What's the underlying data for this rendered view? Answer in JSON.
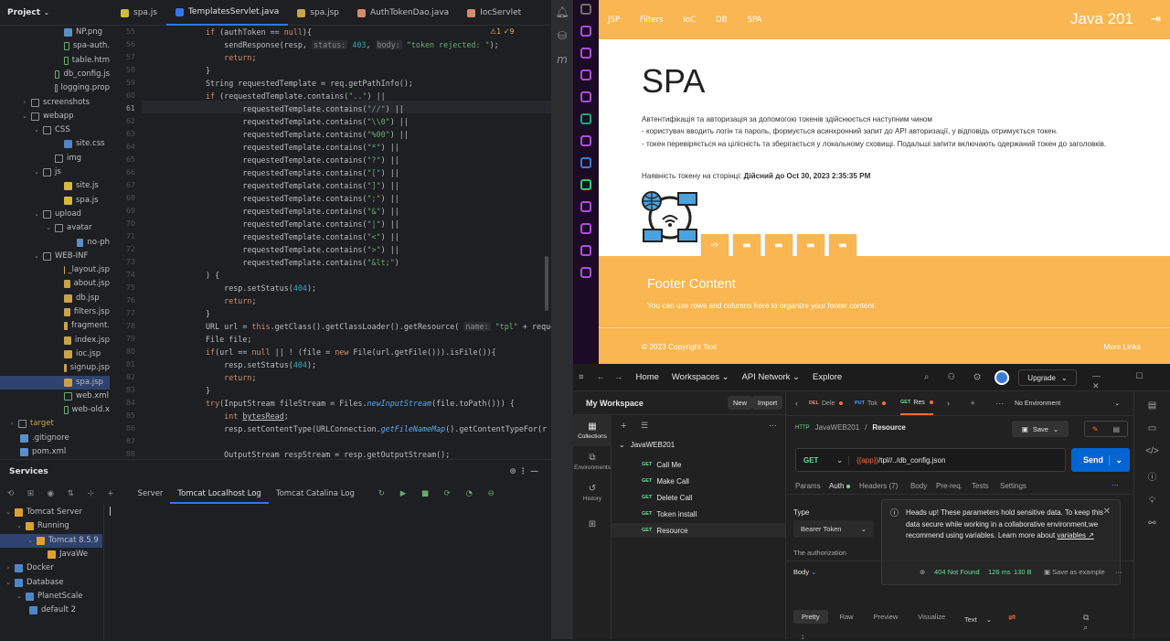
{
  "ide": {
    "project_label": "Project",
    "tabs": [
      {
        "label": "spa.js",
        "color": "#d4b840"
      },
      {
        "label": "TemplatesServlet.java",
        "color": "#3574f0"
      },
      {
        "label": "spa.jsp",
        "color": "#c9a24a"
      },
      {
        "label": "AuthTokenDao.java",
        "color": "#cf8e6d"
      },
      {
        "label": "IocServlet",
        "color": "#cf8e6d"
      }
    ],
    "tree": [
      {
        "label": "NP.png",
        "indent": 70,
        "icon": "file",
        "caret": ""
      },
      {
        "label": "spa-auth.",
        "indent": 70,
        "icon": "html",
        "caret": ""
      },
      {
        "label": "table.htm",
        "indent": 70,
        "icon": "html",
        "caret": ""
      },
      {
        "label": "db_config.js",
        "indent": 60,
        "icon": "html",
        "caret": ""
      },
      {
        "label": "logging.prop",
        "indent": 60,
        "icon": "folder",
        "caret": ""
      },
      {
        "label": "screenshots",
        "indent": 34,
        "icon": "folder",
        "caret": "›"
      },
      {
        "label": "webapp",
        "indent": 34,
        "icon": "folder",
        "caret": "⌄"
      },
      {
        "label": "CSS",
        "indent": 47,
        "icon": "folder",
        "caret": "⌄"
      },
      {
        "label": "site.css",
        "indent": 70,
        "icon": "css",
        "caret": ""
      },
      {
        "label": "img",
        "indent": 60,
        "icon": "folder",
        "caret": ""
      },
      {
        "label": "js",
        "indent": 47,
        "icon": "folder",
        "caret": "⌄"
      },
      {
        "label": "site.js",
        "indent": 70,
        "icon": "js",
        "caret": ""
      },
      {
        "label": "spa.js",
        "indent": 70,
        "icon": "js",
        "caret": ""
      },
      {
        "label": "upload",
        "indent": 47,
        "icon": "folder",
        "caret": "⌄"
      },
      {
        "label": "avatar",
        "indent": 60,
        "icon": "folder",
        "caret": "⌄"
      },
      {
        "label": "no-ph",
        "indent": 84,
        "icon": "file",
        "caret": ""
      },
      {
        "label": "WEB-INF",
        "indent": 47,
        "icon": "folder",
        "caret": "⌄"
      },
      {
        "label": "_layout.jsp",
        "indent": 70,
        "icon": "jsp",
        "caret": ""
      },
      {
        "label": "about.jsp",
        "indent": 70,
        "icon": "jsp",
        "caret": ""
      },
      {
        "label": "db.jsp",
        "indent": 70,
        "icon": "jsp",
        "caret": ""
      },
      {
        "label": "filters.jsp",
        "indent": 70,
        "icon": "jsp",
        "caret": ""
      },
      {
        "label": "fragment.",
        "indent": 70,
        "icon": "jsp",
        "caret": ""
      },
      {
        "label": "index.jsp",
        "indent": 70,
        "icon": "jsp",
        "caret": ""
      },
      {
        "label": "ioc.jsp",
        "indent": 70,
        "icon": "jsp",
        "caret": ""
      },
      {
        "label": "signup.jsp",
        "indent": 70,
        "icon": "jsp",
        "caret": ""
      },
      {
        "label": "spa.jsp",
        "indent": 70,
        "icon": "jsp",
        "caret": ""
      },
      {
        "label": "web.xml",
        "indent": 70,
        "icon": "html",
        "caret": ""
      },
      {
        "label": "web-old.x",
        "indent": 70,
        "icon": "html",
        "caret": ""
      },
      {
        "label": "target",
        "indent": 8,
        "icon": "folder",
        "caret": "›"
      },
      {
        "label": ".gitignore",
        "indent": 22,
        "icon": "file",
        "caret": ""
      },
      {
        "label": "pom.xml",
        "indent": 22,
        "icon": "file",
        "caret": ""
      }
    ],
    "inspections": "⚠1 ✓9",
    "code": [
      {
        "n": "55",
        "h": "<span class=\"k\">if</span> (authToken == <span class=\"k\">null</span>){"
      },
      {
        "n": "56",
        "h": "    sendResponse(resp, <span class=\"h\">status:</span> <span class=\"n\">403</span>, <span class=\"h\">body:</span> <span class=\"s\">\"token rejected: \"</span>);"
      },
      {
        "n": "57",
        "h": "    <span class=\"k\">return</span>;"
      },
      {
        "n": "58",
        "h": "}"
      },
      {
        "n": "59",
        "h": "String requestedTemplate = req.getPathInfo();"
      },
      {
        "n": "60",
        "h": "<span class=\"k\">if</span> (requestedTemplate.contains(<span class=\"s\">\"..\"</span>) ||"
      },
      {
        "n": "61",
        "h": "        requestedTemplate.contains(<span class=\"s\">\"//\"</span>) ||"
      },
      {
        "n": "62",
        "h": "        requestedTemplate.contains(<span class=\"s\">\"\\\\0\"</span>) ||"
      },
      {
        "n": "63",
        "h": "        requestedTemplate.contains(<span class=\"s\">\"%00\"</span>) ||"
      },
      {
        "n": "64",
        "h": "        requestedTemplate.contains(<span class=\"s\">\"*\"</span>) ||"
      },
      {
        "n": "65",
        "h": "        requestedTemplate.contains(<span class=\"s\">\"?\"</span>) ||"
      },
      {
        "n": "66",
        "h": "        requestedTemplate.contains(<span class=\"s\">\"[\"</span>) ||"
      },
      {
        "n": "67",
        "h": "        requestedTemplate.contains(<span class=\"s\">\"]\"</span>) ||"
      },
      {
        "n": "68",
        "h": "        requestedTemplate.contains(<span class=\"s\">\";\"</span>) ||"
      },
      {
        "n": "69",
        "h": "        requestedTemplate.contains(<span class=\"s\">\"&amp;\"</span>) ||"
      },
      {
        "n": "70",
        "h": "        requestedTemplate.contains(<span class=\"s\">\"|\"</span>) ||"
      },
      {
        "n": "71",
        "h": "        requestedTemplate.contains(<span class=\"s\">\"&lt;\"</span>) ||"
      },
      {
        "n": "72",
        "h": "        requestedTemplate.contains(<span class=\"s\">\"&gt;\"</span>) ||"
      },
      {
        "n": "73",
        "h": "        requestedTemplate.contains(<span class=\"s\">\"&amp;lt;\"</span>)"
      },
      {
        "n": "74",
        "h": ") {"
      },
      {
        "n": "75",
        "h": "    resp.setStatus(<span class=\"n\">404</span>);"
      },
      {
        "n": "76",
        "h": "    <span class=\"k\">return</span>;"
      },
      {
        "n": "77",
        "h": "}"
      },
      {
        "n": "78",
        "h": "URL url = <span class=\"k\">this</span>.getClass().getClassLoader().getResource( <span class=\"h\">name:</span> <span class=\"s\">\"tpl\"</span> + reque"
      },
      {
        "n": "79",
        "h": "File file;"
      },
      {
        "n": "80",
        "h": "<span class=\"k\">if</span>(url == <span class=\"k\">null</span> || ! (file = <span class=\"k\">new</span> File(url.getFile())).isFile()){"
      },
      {
        "n": "81",
        "h": "    resp.setStatus(<span class=\"n\">404</span>);"
      },
      {
        "n": "82",
        "h": "    <span class=\"k\">return</span>;"
      },
      {
        "n": "83",
        "h": "}"
      },
      {
        "n": "84",
        "h": "<span class=\"k\">try</span>(InputStream fileStream = Files.<span class=\"i\">newInputStream</span>(file.toPath())) {"
      },
      {
        "n": "85",
        "h": "    <span class=\"k\">int</span> <u>bytesRead</u>;"
      },
      {
        "n": "86",
        "h": "    resp.setContentType(URLConnection.<span class=\"i\">getFileNameMap</span>().getContentTypeFor(r"
      },
      {
        "n": "87",
        "h": ""
      },
      {
        "n": "88",
        "h": "    OutputStream respStream = resp.getOutputStream();"
      }
    ],
    "services": {
      "title": "Services",
      "tabs": [
        "Server",
        "Tomcat Localhost Log",
        "Tomcat Catalina Log"
      ],
      "active_tab": "Tomcat Localhost Log",
      "tree": [
        {
          "label": "Tomcat Server",
          "indent": 12,
          "caret": "⌄"
        },
        {
          "label": "Running",
          "indent": 24,
          "caret": "⌄"
        },
        {
          "label": "Tomcat 8.5.9",
          "indent": 36,
          "caret": "⌄"
        },
        {
          "label": "JavaWe",
          "indent": 60,
          "caret": ""
        },
        {
          "label": "Docker",
          "indent": 12,
          "caret": "›"
        },
        {
          "label": "Database",
          "indent": 12,
          "caret": "⌄"
        },
        {
          "label": "PlanetScale",
          "indent": 24,
          "caret": "⌄"
        },
        {
          "label": "default 2",
          "indent": 40,
          "caret": ""
        }
      ]
    }
  },
  "browser": {
    "nav": [
      "JSP",
      "Filters",
      "IoC",
      "DB",
      "SPA"
    ],
    "brand": "Java 201",
    "title": "SPA",
    "intro": "Автентифікація та авторизація за допомогою токенів здійснюється наступним чином",
    "line1": "- користувач вводить логін та пароль, формується асинхронний запит до API авторизації, у відповідь отримується токен.",
    "line2": "- токен перевіряється на цілісність та зберігається у локальному сховищі. Подальші запити включають одержаний токен до заголовків.",
    "token_label": "Наявність токену на сторінці:",
    "token_value": "Дійсний до Oct 30, 2023 2:35:35 PM",
    "footer_title": "Footer Content",
    "footer_text": "You can use rows and columns here to organize your footer content.",
    "copyright": "© 2023 Copyright Text",
    "more_links": "More Links",
    "accent": "#f9b651"
  },
  "postman": {
    "nav": {
      "home": "Home",
      "workspaces": "Workspaces",
      "api_network": "API Network",
      "explore": "Explore",
      "upgrade": "Upgrade"
    },
    "workspace": "My Workspace",
    "new_btn": "New",
    "import_btn": "Import",
    "sidebar": [
      "Collections",
      "Environments",
      "History"
    ],
    "collection": "JavaWEB201",
    "requests": [
      "Call Me",
      "Make Call",
      "Delete Call",
      "Token install",
      "Resource"
    ],
    "tabs": [
      {
        "method": "DEL",
        "label": "Dele",
        "color": "#f08080"
      },
      {
        "method": "PUT",
        "label": "Tok",
        "color": "#4da3ff"
      },
      {
        "method": "GET",
        "label": "Res",
        "color": "#6bdd9a"
      }
    ],
    "environment": "No Environment",
    "breadcrumb_parent": "JavaWEB201",
    "breadcrumb_current": "Resource",
    "save": "Save",
    "method": "GET",
    "url_var": "{{app}}",
    "url_path": "/tpl//../db_config.json",
    "send": "Send",
    "req_tabs": [
      "Params",
      "Auth",
      "Headers (7)",
      "Body",
      "Pre-req.",
      "Tests",
      "Settings"
    ],
    "type_label": "Type",
    "type_value": "Bearer Token",
    "auth_text": "The authorization",
    "notice": "Heads up! These parameters hold sensitive data. To keep this data secure while working in a collaborative environment,we recommend using variables. Learn more about",
    "notice_link": "variables ↗",
    "response_label": "Body",
    "status": "404 Not Found",
    "time": "126 ms",
    "size": "130 B",
    "save_example": "Save as example",
    "resp_tabs": [
      "Pretty",
      "Raw",
      "Preview",
      "Visualize"
    ],
    "format": "Text",
    "line_no": "1"
  }
}
